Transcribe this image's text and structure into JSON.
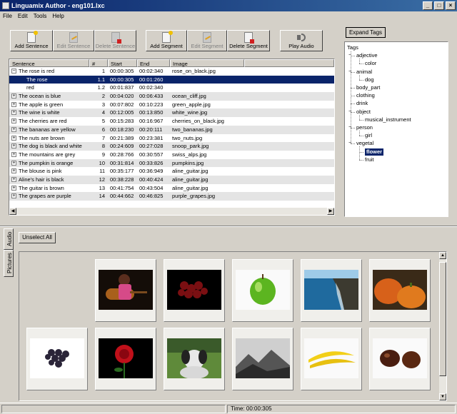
{
  "window": {
    "title": "Linguamix Author  -  eng101.lxc"
  },
  "menu": [
    "File",
    "Edit",
    "Tools",
    "Help"
  ],
  "toolbar": [
    {
      "label": "Add Sentence",
      "enabled": true,
      "icon": "add-sentence-icon"
    },
    {
      "label": "Edit Sentence",
      "enabled": false,
      "icon": "edit-sentence-icon"
    },
    {
      "label": "Delete Sentence",
      "enabled": false,
      "icon": "delete-sentence-icon"
    },
    {
      "label": "Add Segment",
      "enabled": true,
      "icon": "add-segment-icon"
    },
    {
      "label": "Edit Segment",
      "enabled": false,
      "icon": "edit-segment-icon"
    },
    {
      "label": "Delete Segment",
      "enabled": true,
      "icon": "delete-segment-icon"
    },
    {
      "label": "Play Audio",
      "enabled": true,
      "icon": "speaker-icon"
    }
  ],
  "table": {
    "columns": [
      "Sentence",
      "#",
      "Start",
      "End",
      "Image"
    ],
    "rows": [
      {
        "sentence": "The rose is red",
        "num": "1",
        "start": "00:00:305",
        "end": "00:02:340",
        "image": "rose_on_black.jpg",
        "expander": "−",
        "level": 0
      },
      {
        "sentence": "The rose",
        "num": "1.1",
        "start": "00:00:305",
        "end": "00:01:260",
        "image": "",
        "level": 1,
        "selected": true
      },
      {
        "sentence": "red",
        "num": "1.2",
        "start": "00:01:837",
        "end": "00:02:340",
        "image": "",
        "level": 1
      },
      {
        "sentence": "The ocean is blue",
        "num": "2",
        "start": "00:04:020",
        "end": "00:06:433",
        "image": "ocean_cliff.jpg",
        "expander": "+",
        "level": 0
      },
      {
        "sentence": "The apple is green",
        "num": "3",
        "start": "00:07:802",
        "end": "00:10:223",
        "image": "green_apple.jpg",
        "expander": "+",
        "level": 0
      },
      {
        "sentence": "The wine is white",
        "num": "4",
        "start": "00:12:005",
        "end": "00:13:850",
        "image": "white_wine.jpg",
        "expander": "+",
        "level": 0
      },
      {
        "sentence": "The cherries are red",
        "num": "5",
        "start": "00:15:283",
        "end": "00:16:967",
        "image": "cherries_on_black.jpg",
        "expander": "+",
        "level": 0
      },
      {
        "sentence": "The bananas are yellow",
        "num": "6",
        "start": "00:18:230",
        "end": "00:20:111",
        "image": "two_bananas.jpg",
        "expander": "+",
        "level": 0
      },
      {
        "sentence": "The nuts are brown",
        "num": "7",
        "start": "00:21:389",
        "end": "00:23:381",
        "image": "two_nuts.jpg",
        "expander": "+",
        "level": 0
      },
      {
        "sentence": "The dog is black and white",
        "num": "8",
        "start": "00:24:609",
        "end": "00:27:028",
        "image": "snoop_park.jpg",
        "expander": "+",
        "level": 0
      },
      {
        "sentence": "The mountains are grey",
        "num": "9",
        "start": "00:28:766",
        "end": "00:30:557",
        "image": "swiss_alps.jpg",
        "expander": "+",
        "level": 0
      },
      {
        "sentence": "The pumpkin is orange",
        "num": "10",
        "start": "00:31:814",
        "end": "00:33:826",
        "image": "pumpkins.jpg",
        "expander": "+",
        "level": 0
      },
      {
        "sentence": "The blouse is pink",
        "num": "11",
        "start": "00:35:177",
        "end": "00:36:949",
        "image": "aline_guitar.jpg",
        "expander": "+",
        "level": 0
      },
      {
        "sentence": "Aline's hair is black",
        "num": "12",
        "start": "00:38:228",
        "end": "00:40:424",
        "image": "aline_guitar.jpg",
        "expander": "+",
        "level": 0
      },
      {
        "sentence": "The guitar is brown",
        "num": "13",
        "start": "00:41:754",
        "end": "00:43:504",
        "image": "aline_guitar.jpg",
        "expander": "+",
        "level": 0
      },
      {
        "sentence": "The grapes are purple",
        "num": "14",
        "start": "00:44:662",
        "end": "00:46:825",
        "image": "purple_grapes.jpg",
        "expander": "+",
        "level": 0
      }
    ]
  },
  "tags": {
    "expand_button": "Expand Tags",
    "root": "Tags",
    "nodes": [
      {
        "label": "adjective",
        "depth": 1
      },
      {
        "label": "color",
        "depth": 2
      },
      {
        "label": "animal",
        "depth": 1
      },
      {
        "label": "dog",
        "depth": 2
      },
      {
        "label": "body_part",
        "depth": 1
      },
      {
        "label": "clothing",
        "depth": 1
      },
      {
        "label": "drink",
        "depth": 1
      },
      {
        "label": "object",
        "depth": 1
      },
      {
        "label": "musical_instrument",
        "depth": 2
      },
      {
        "label": "person",
        "depth": 1
      },
      {
        "label": "girl",
        "depth": 2
      },
      {
        "label": "vegetal",
        "depth": 1
      },
      {
        "label": "flower",
        "depth": 2,
        "selected": true
      },
      {
        "label": "fruit",
        "depth": 2
      }
    ]
  },
  "side_tabs": [
    "Audio",
    "Pictures"
  ],
  "pictures": {
    "unselect_all": "Unselect All",
    "thumbnails": [
      {
        "name": "girl-guitar-photo"
      },
      {
        "name": "cherries-photo"
      },
      {
        "name": "green-apple-photo"
      },
      {
        "name": "ocean-cliff-photo"
      },
      {
        "name": "pumpkins-photo"
      },
      {
        "name": "grapes-photo"
      },
      {
        "name": "rose-photo"
      },
      {
        "name": "dog-photo"
      },
      {
        "name": "mountains-photo"
      },
      {
        "name": "bananas-photo"
      },
      {
        "name": "nuts-photo"
      }
    ]
  },
  "status": {
    "time": "Time: 00:00:305"
  },
  "colors": {
    "selection": "#0a246a",
    "title_start": "#0a246a",
    "title_end": "#3a6ea5",
    "face": "#d4d0c8"
  }
}
